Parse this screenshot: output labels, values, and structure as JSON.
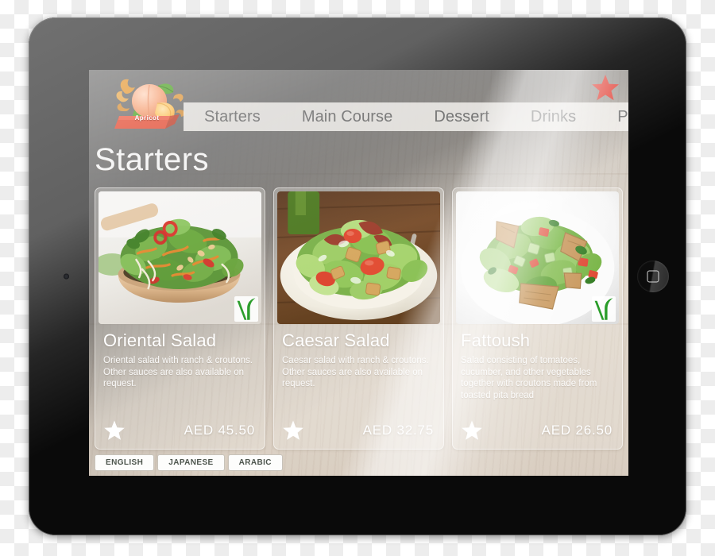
{
  "device": {
    "type": "tablet",
    "orientation": "landscape",
    "home_button": "home-button",
    "bezel_color": "#0a0a0a"
  },
  "app": {
    "brand": {
      "name": "Apricot",
      "ribbon_color": "#e4563f",
      "fruit_color": "#f4a98a"
    },
    "accent_star_color": "#e03a2f",
    "page_title": "Starters"
  },
  "nav": {
    "tabs": [
      {
        "label": "Starters",
        "active": true
      },
      {
        "label": "Main Course",
        "active": false
      },
      {
        "label": "Dessert",
        "active": false
      },
      {
        "label": "Drinks",
        "active": false
      },
      {
        "label": "Promoti",
        "active": false
      }
    ]
  },
  "menu": {
    "currency": "AED",
    "items": [
      {
        "name": "Oriental Salad",
        "description": "Oriental salad with ranch & croutons. Other sauces are also available on request.",
        "price": "AED  45.50",
        "vegetarian": true,
        "veg_badge_label": "V",
        "favorite_icon": "star-icon",
        "photo": "oriental-salad-photo"
      },
      {
        "name": "Caesar Salad",
        "description": "Caesar salad with ranch & croutons. Other sauces are also available on request.",
        "price": "AED  32.75",
        "vegetarian": false,
        "veg_badge_label": "",
        "favorite_icon": "star-icon",
        "photo": "caesar-salad-photo"
      },
      {
        "name": "Fattoush",
        "description": "Salad consisting of tomatoes, cucumber, and other vegetables together with croutons made from toasted pita bread",
        "price": "AED  26.50",
        "vegetarian": true,
        "veg_badge_label": "V",
        "favorite_icon": "star-icon",
        "photo": "fattoush-photo"
      }
    ]
  },
  "languages": {
    "options": [
      {
        "label": "ENGLISH",
        "selected": true
      },
      {
        "label": "JAPANESE",
        "selected": false
      },
      {
        "label": "ARABIC",
        "selected": false
      }
    ]
  }
}
